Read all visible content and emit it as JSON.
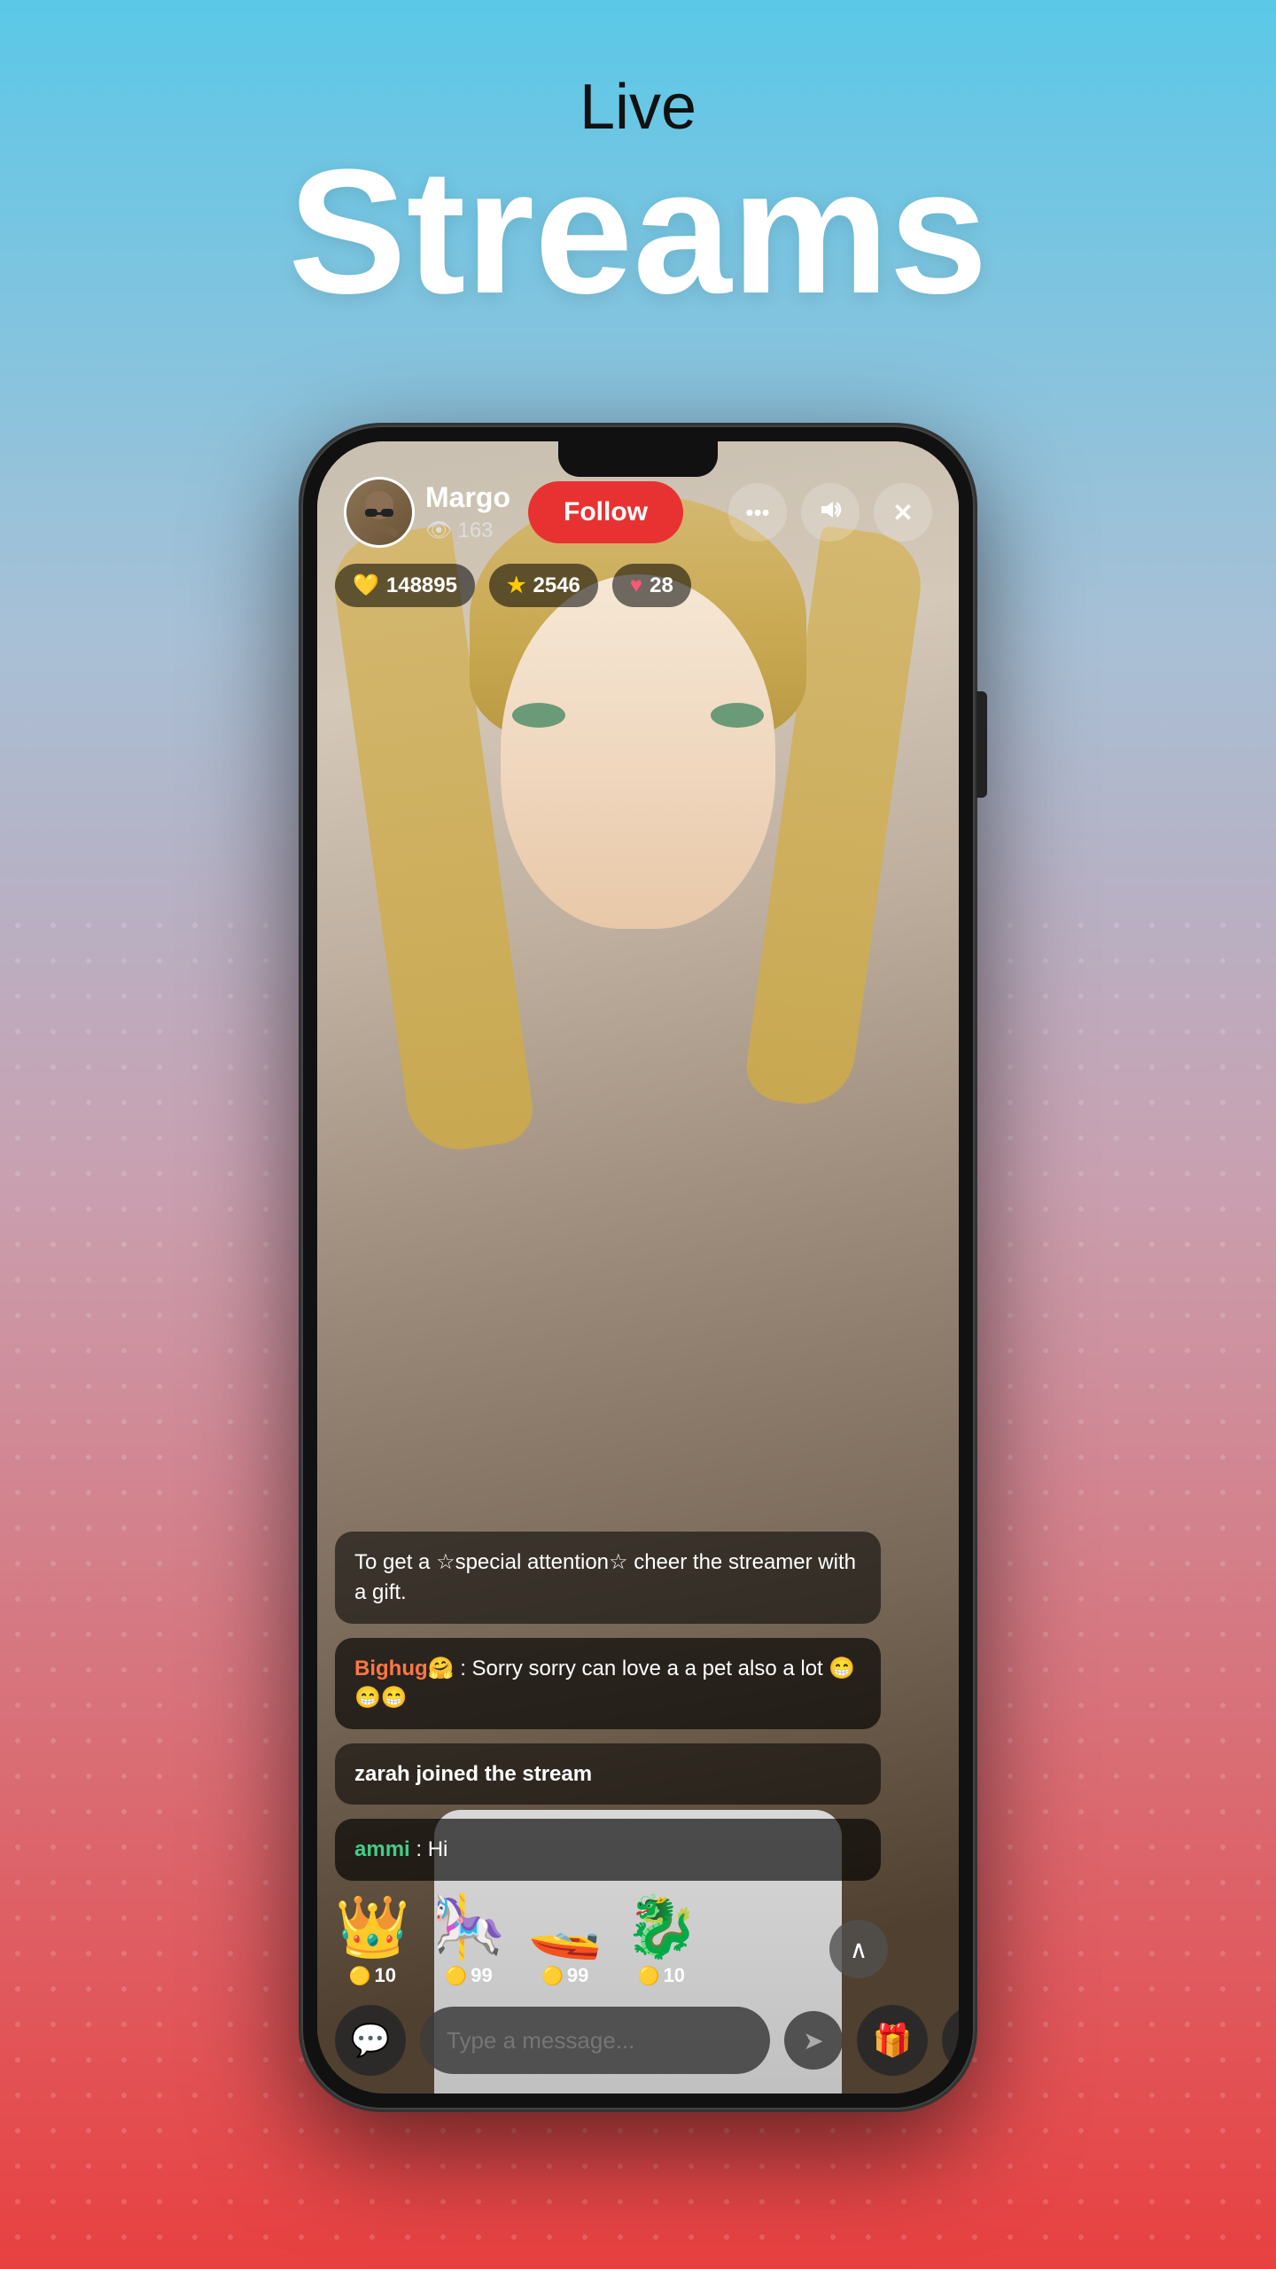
{
  "page": {
    "background_gradient": "linear-gradient(180deg, #5bc8e8 0%, #a8c0d6 30%, #c9a0b0 55%, #e84040 100%)",
    "title_live": "Live",
    "title_streams": "Streams"
  },
  "phone": {
    "streamer": {
      "name": "Margo",
      "viewer_count": "163",
      "follow_label": "Follow"
    },
    "stats": {
      "coins": "148895",
      "stars": "2546",
      "hearts": "28"
    },
    "chat": [
      {
        "type": "system",
        "text": "To get a ☆special attention☆ cheer the streamer with a gift."
      },
      {
        "type": "user",
        "username": "Bighug🤗",
        "message": ": Sorry sorry can love a a pet also a lot 😁😁😁"
      },
      {
        "type": "join",
        "text": "zarah joined the stream"
      },
      {
        "type": "user",
        "username": "ammi",
        "message": ": Hi"
      }
    ],
    "gifts": [
      {
        "emoji": "👑",
        "cost": "10"
      },
      {
        "emoji": "🎠",
        "cost": "99"
      },
      {
        "emoji": "🚤",
        "cost": "99"
      },
      {
        "emoji": "🐉",
        "cost": "10"
      }
    ],
    "bottom_bar": {
      "message_placeholder": "Type a message..."
    },
    "icons": {
      "more": "⋯",
      "volume": "🔊",
      "close": "✕",
      "eye": "👁",
      "chat_bubble": "💬",
      "send": "➤",
      "gift": "🎁",
      "heart": "♡",
      "scroll_up": "∧"
    }
  }
}
